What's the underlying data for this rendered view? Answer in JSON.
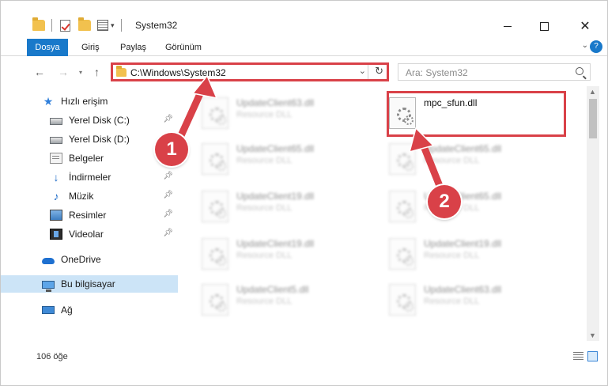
{
  "window": {
    "title": "System32",
    "controls": {
      "minimize": "",
      "maximize": "",
      "close": "✕"
    }
  },
  "ribbon": {
    "tabs": [
      "Dosya",
      "Giriş",
      "Paylaş",
      "Görünüm"
    ],
    "help": "?"
  },
  "address_bar": {
    "path": "C:\\Windows\\System32",
    "search_placeholder": "Ara: System32"
  },
  "sidebar": {
    "items": [
      {
        "label": "Hızlı erişim",
        "icon": "star-icon",
        "pinned": false
      },
      {
        "label": "Yerel Disk (C:)",
        "icon": "drive-icon",
        "pinned": true
      },
      {
        "label": "Yerel Disk (D:)",
        "icon": "drive-icon",
        "pinned": true
      },
      {
        "label": "Belgeler",
        "icon": "documents-icon",
        "pinned": false
      },
      {
        "label": "İndirmeler",
        "icon": "download-icon",
        "pinned": true
      },
      {
        "label": "Müzik",
        "icon": "music-icon",
        "pinned": true
      },
      {
        "label": "Resimler",
        "icon": "pictures-icon",
        "pinned": true
      },
      {
        "label": "Videolar",
        "icon": "videos-icon",
        "pinned": true
      },
      {
        "label": "OneDrive",
        "icon": "cloud-icon",
        "pinned": false
      },
      {
        "label": "Bu bilgisayar",
        "icon": "computer-icon",
        "pinned": false
      },
      {
        "label": "Ağ",
        "icon": "network-icon",
        "pinned": false
      }
    ]
  },
  "files": [
    {
      "name": "UpdateClient63.dll",
      "type": "Resource DLL",
      "blurred": true
    },
    {
      "name": "mpc_sfun.dll",
      "type": "",
      "blurred": false
    },
    {
      "name": "UpdateClient65.dll",
      "type": "Resource DLL",
      "blurred": true
    },
    {
      "name": "UpdateClient65.dll",
      "type": "Resource DLL",
      "blurred": true
    },
    {
      "name": "UpdateClient19.dll",
      "type": "Resource DLL",
      "blurred": true
    },
    {
      "name": "UpdateClient65.dll",
      "type": "Resource DLL",
      "blurred": true
    },
    {
      "name": "UpdateClient19.dll",
      "type": "Resource DLL",
      "blurred": true
    },
    {
      "name": "UpdateClient19.dll",
      "type": "Resource DLL",
      "blurred": true
    },
    {
      "name": "UpdateClient5.dll",
      "type": "Resource DLL",
      "blurred": true
    },
    {
      "name": "UpdateClient63.dll",
      "type": "Resource DLL",
      "blurred": true
    }
  ],
  "status": {
    "item_count": "106 öğe"
  },
  "annotations": {
    "step1": "1",
    "step2": "2",
    "accent_color": "#d94148"
  }
}
